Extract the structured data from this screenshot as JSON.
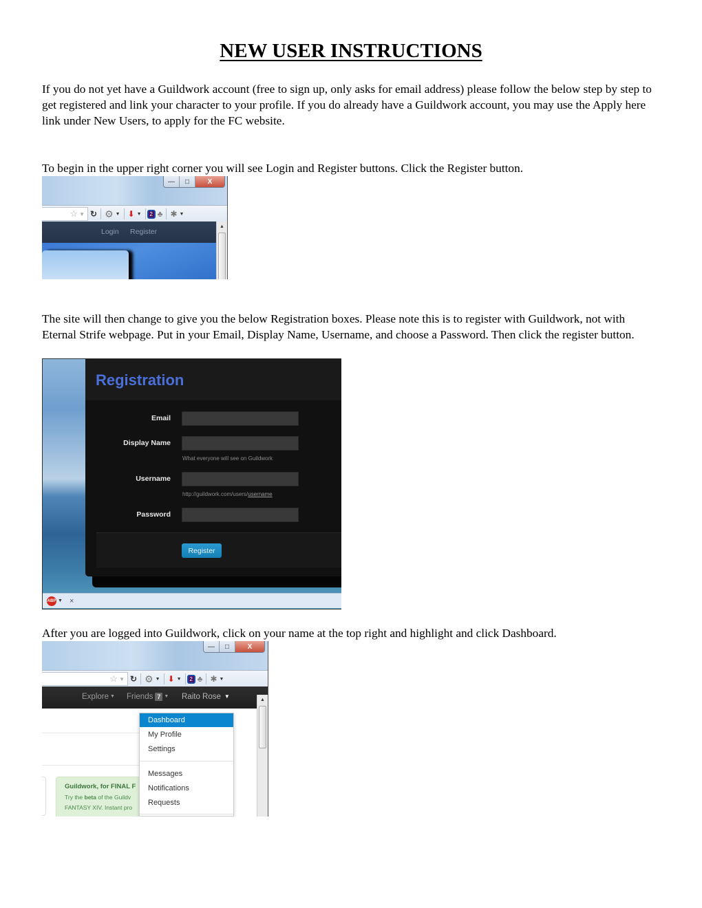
{
  "document": {
    "title": "NEW USER INSTRUCTIONS",
    "paragraphs": [
      "If you do not yet have a Guildwork account (free to sign up, only asks for email address) please follow the below step by step to get registered and link your character to your profile.  If you do already have a Guildwork account, you may use the Apply here link under New Users, to apply for the FC website.",
      "To begin in the upper right corner you will see Login and Register buttons.   Click the Register button.",
      "The site will then change to give you the below Registration boxes.  Please note this is to register with Guildwork, not with Eternal Strife webpage.  Put in your Email, Display Name, Username, and choose a Password.  Then click the register button.",
      "After you are logged into Guildwork, click on your name at the top right and highlight and click Dashboard."
    ]
  },
  "screenshot1": {
    "window_controls": {
      "minimize": "—",
      "maximize": "□",
      "close": "X"
    },
    "icons": [
      "star-icon",
      "reload-icon",
      "gear-icon",
      "download-icon",
      "notification-badge-icon",
      "addon-icon",
      "bug-icon"
    ],
    "badge_count": "2",
    "nav": {
      "login": "Login",
      "register": "Register"
    }
  },
  "screenshot2": {
    "heading": "Registration",
    "fields": [
      {
        "label": "Email",
        "value": "",
        "help": ""
      },
      {
        "label": "Display Name",
        "value": "",
        "help": "What everyone will see on Guildwork"
      },
      {
        "label": "Username",
        "value": "",
        "help_prefix": "http://guildwork.com/users/",
        "help_link": "username"
      },
      {
        "label": "Password",
        "value": "",
        "help": ""
      }
    ],
    "submit_label": "Register",
    "addon_bar": {
      "abp_label": "ABP",
      "close": "×"
    }
  },
  "screenshot3": {
    "window_controls": {
      "minimize": "—",
      "maximize": "□",
      "close": "X"
    },
    "badge_count": "2",
    "nav": {
      "explore": "Explore",
      "friends": "Friends",
      "friends_count": "7",
      "user": "Raito Rose"
    },
    "menu_items": [
      {
        "label": "Dashboard",
        "active": true
      },
      {
        "label": "My Profile",
        "active": false
      },
      {
        "label": "Settings",
        "active": false
      },
      {
        "label": "Messages",
        "active": false
      },
      {
        "label": "Notifications",
        "active": false
      },
      {
        "label": "Requests",
        "active": false
      }
    ],
    "notice": {
      "title": "Guildwork, for FINAL F",
      "line1_pre": "Try the ",
      "line1_bold": "beta",
      "line1_post": " of the Guildv",
      "line2": "FANTASY XIV. Instant pro"
    }
  },
  "colors": {
    "registration_heading": "#4a6fd9",
    "register_button": "#1a8cc4",
    "menu_active": "#0b86cf",
    "notice_bg": "#dff0d8",
    "notice_text": "#3c763d"
  }
}
